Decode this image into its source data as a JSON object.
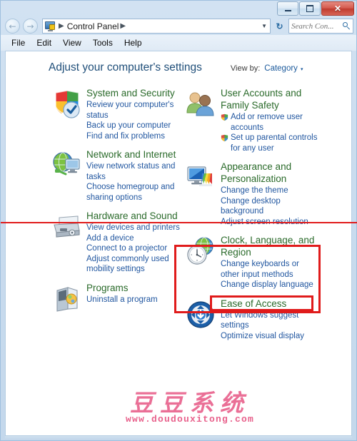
{
  "window": {
    "caption_buttons": [
      {
        "name": "minimize",
        "glyph": "minimize-icon"
      },
      {
        "name": "maximize",
        "glyph": "maximize-icon"
      },
      {
        "name": "close",
        "glyph": "✕"
      }
    ]
  },
  "navbar": {
    "back_glyph": "←",
    "forward_glyph": "→",
    "breadcrumb_icon": "control-panel-icon",
    "breadcrumb_sep_leading": "▶",
    "breadcrumb_text": "Control Panel",
    "breadcrumb_sep_trailing": "▶",
    "dropdown_caret": "▼",
    "refresh_glyph": "↻",
    "search_placeholder": "Search Con...",
    "search_value": "",
    "search_icon": "magnifier-icon"
  },
  "menubar": {
    "items": [
      "File",
      "Edit",
      "View",
      "Tools",
      "Help"
    ]
  },
  "header": {
    "title": "Adjust your computer's settings",
    "view_by_label": "View by:",
    "view_by_value": "Category",
    "view_by_caret": "▾"
  },
  "categories": {
    "left": [
      {
        "icon": "shield-security-icon",
        "title": "System and Security",
        "links": [
          {
            "text": "Review your computer's status",
            "shield": false
          },
          {
            "text": "Back up your computer",
            "shield": false
          },
          {
            "text": "Find and fix problems",
            "shield": false
          }
        ]
      },
      {
        "icon": "network-globe-monitor-icon",
        "title": "Network and Internet",
        "links": [
          {
            "text": "View network status and tasks",
            "shield": false
          },
          {
            "text": "Choose homegroup and sharing options",
            "shield": false
          }
        ]
      },
      {
        "icon": "printer-hardware-icon",
        "title": "Hardware and Sound",
        "links": [
          {
            "text": "View devices and printers",
            "shield": false
          },
          {
            "text": "Add a device",
            "shield": false
          },
          {
            "text": "Connect to a projector",
            "shield": false
          },
          {
            "text": "Adjust commonly used mobility settings",
            "shield": false
          }
        ]
      },
      {
        "icon": "programs-box-icon",
        "title": "Programs",
        "links": [
          {
            "text": "Uninstall a program",
            "shield": false
          }
        ]
      }
    ],
    "right": [
      {
        "icon": "user-accounts-people-icon",
        "title": "User Accounts and Family Safety",
        "links": [
          {
            "text": "Add or remove user accounts",
            "shield": true
          },
          {
            "text": "Set up parental controls for any user",
            "shield": true
          }
        ]
      },
      {
        "icon": "appearance-monitor-icon",
        "title": "Appearance and Personalization",
        "links": [
          {
            "text": "Change the theme",
            "shield": false
          },
          {
            "text": "Change desktop background",
            "shield": false
          },
          {
            "text": "Adjust screen resolution",
            "shield": false
          }
        ]
      },
      {
        "icon": "clock-globe-icon",
        "title": "Clock, Language, and Region",
        "links": [
          {
            "text": "Change keyboards or other input methods",
            "shield": false
          },
          {
            "text": "Change display language",
            "shield": false
          }
        ]
      },
      {
        "icon": "ease-of-access-icon",
        "title": "Ease of Access",
        "links": [
          {
            "text": "Let Windows suggest settings",
            "shield": false
          },
          {
            "text": "Optimize visual display",
            "shield": false
          }
        ]
      }
    ]
  },
  "annotations": {
    "red_color": "#e01b1b",
    "highlight_line": "horizontal-divider-line",
    "highlight_box_outer": "clock-language-region-section",
    "highlight_box_inner": "change-display-language-link"
  },
  "watermark": {
    "brand_cn": "豆豆系统",
    "url": "www.doudouxitong.com",
    "color": "#e2386e"
  }
}
